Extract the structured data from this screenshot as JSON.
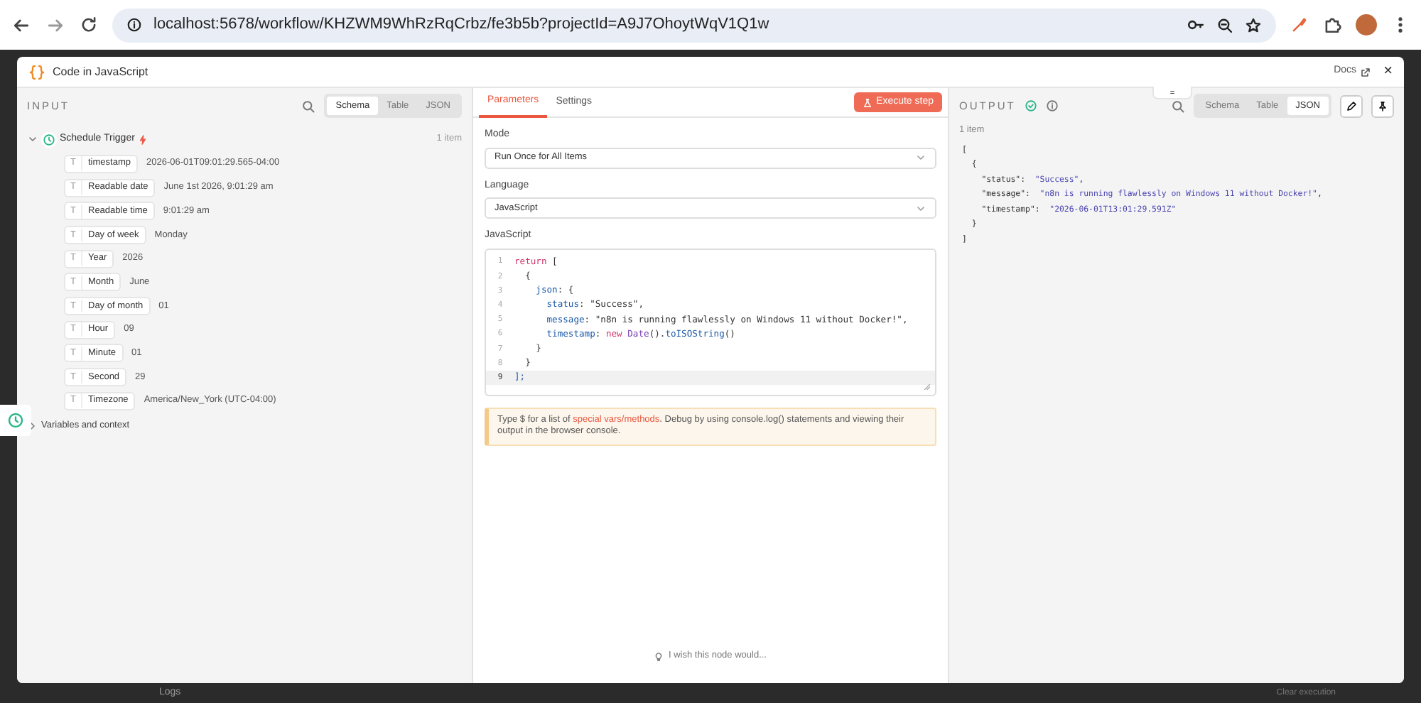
{
  "browser": {
    "url": "localhost:5678/workflow/KHZWM9WhRzRqCrbz/fe3b5b?projectId=A9J7OhoytWqV1Q1w"
  },
  "backdrop": {
    "logs": "Logs",
    "clear": "Clear execution"
  },
  "modal": {
    "title": "Code in JavaScript",
    "docs": "Docs",
    "close": "×"
  },
  "input": {
    "heading": "INPUT",
    "view_tabs": [
      {
        "label": "Schema",
        "selected": true
      },
      {
        "label": "Table",
        "selected": false
      },
      {
        "label": "JSON",
        "selected": false
      }
    ],
    "node": {
      "name": "Schedule Trigger",
      "count": "1 item",
      "expanded": true,
      "fields": [
        {
          "icon": "T",
          "key": "timestamp",
          "value": "2026-06-01T09:01:29.565-04:00"
        },
        {
          "icon": "T",
          "key": "Readable date",
          "value": "June 1st 2026, 9:01:29 am"
        },
        {
          "icon": "T",
          "key": "Readable time",
          "value": "9:01:29 am"
        },
        {
          "icon": "T",
          "key": "Day of week",
          "value": "Monday"
        },
        {
          "icon": "T",
          "key": "Year",
          "value": "2026"
        },
        {
          "icon": "T",
          "key": "Month",
          "value": "June"
        },
        {
          "icon": "T",
          "key": "Day of month",
          "value": "01"
        },
        {
          "icon": "T",
          "key": "Hour",
          "value": "09"
        },
        {
          "icon": "T",
          "key": "Minute",
          "value": "01"
        },
        {
          "icon": "T",
          "key": "Second",
          "value": "29"
        },
        {
          "icon": "T",
          "key": "Timezone",
          "value": "America/New_York (UTC-04:00)"
        }
      ]
    },
    "variables": {
      "label": "Variables and context",
      "expanded": false
    }
  },
  "parameters": {
    "tabs": [
      {
        "label": "Parameters",
        "selected": true
      },
      {
        "label": "Settings",
        "selected": false
      }
    ],
    "execute": "Execute step",
    "fields": [
      {
        "label": "Mode",
        "value": "Run Once for All Items"
      },
      {
        "label": "Language",
        "value": "JavaScript"
      }
    ],
    "code_label": "JavaScript",
    "code": [
      {
        "number": "1",
        "selected": false,
        "tokens": [
          {
            "kind": "keyword",
            "text": "return"
          },
          {
            "kind": "plain",
            "text": " ["
          }
        ]
      },
      {
        "number": "2",
        "selected": false,
        "tokens": [
          {
            "kind": "plain",
            "text": "  {"
          }
        ]
      },
      {
        "number": "3",
        "selected": false,
        "tokens": [
          {
            "kind": "property",
            "text": "    json"
          },
          {
            "kind": "plain",
            "text": ": {"
          }
        ]
      },
      {
        "number": "4",
        "selected": false,
        "tokens": [
          {
            "kind": "property",
            "text": "      status"
          },
          {
            "kind": "plain",
            "text": ": \"Success\","
          }
        ]
      },
      {
        "number": "5",
        "selected": false,
        "tokens": [
          {
            "kind": "property",
            "text": "      message"
          },
          {
            "kind": "plain",
            "text": ": \"n8n is running flawlessly on Windows 11 without Docker!\","
          }
        ]
      },
      {
        "number": "6",
        "selected": false,
        "tokens": [
          {
            "kind": "property",
            "text": "      timestamp"
          },
          {
            "kind": "plain",
            "text": ": "
          },
          {
            "kind": "keyword",
            "text": "new"
          },
          {
            "kind": "class",
            "text": " Date"
          },
          {
            "kind": "plain",
            "text": "()."
          },
          {
            "kind": "property",
            "text": "toISOString"
          },
          {
            "kind": "plain",
            "text": "()"
          }
        ]
      },
      {
        "number": "7",
        "selected": false,
        "tokens": [
          {
            "kind": "plain",
            "text": "    }"
          }
        ]
      },
      {
        "number": "8",
        "selected": false,
        "tokens": [
          {
            "kind": "plain",
            "text": "  }"
          }
        ]
      },
      {
        "number": "9",
        "selected": true,
        "tokens": [
          {
            "kind": "property",
            "text": "];"
          }
        ]
      }
    ],
    "hint": {
      "before": "Type $ for a list of ",
      "link": "special vars/methods",
      "after": ". Debug by using console.log() statements and viewing their output in the browser console."
    },
    "feedback": "I wish this node would..."
  },
  "output": {
    "heading": "OUTPUT",
    "view_tabs": [
      {
        "label": "Schema",
        "selected": false
      },
      {
        "label": "Table",
        "selected": false
      },
      {
        "label": "JSON",
        "selected": true
      }
    ],
    "count": "1 item",
    "json": [
      {
        "tokens": [
          {
            "kind": "plain",
            "text": "["
          }
        ]
      },
      {
        "tokens": [
          {
            "kind": "plain",
            "text": "  {"
          }
        ]
      },
      {
        "tokens": [
          {
            "kind": "plain",
            "text": "    \"status\": "
          },
          {
            "kind": "string",
            "text": " \"Success\""
          },
          {
            "kind": "plain",
            "text": ","
          }
        ]
      },
      {
        "tokens": [
          {
            "kind": "plain",
            "text": "    \"message\": "
          },
          {
            "kind": "string",
            "text": " \"n8n is running flawlessly on Windows 11 without Docker!\""
          },
          {
            "kind": "plain",
            "text": ","
          }
        ]
      },
      {
        "tokens": [
          {
            "kind": "plain",
            "text": "    \"timestamp\": "
          },
          {
            "kind": "string",
            "text": " \"2026-06-01T13:01:29.591Z\""
          }
        ]
      },
      {
        "tokens": [
          {
            "kind": "plain",
            "text": "  }"
          }
        ]
      },
      {
        "tokens": [
          {
            "kind": "plain",
            "text": "]"
          }
        ]
      }
    ]
  }
}
